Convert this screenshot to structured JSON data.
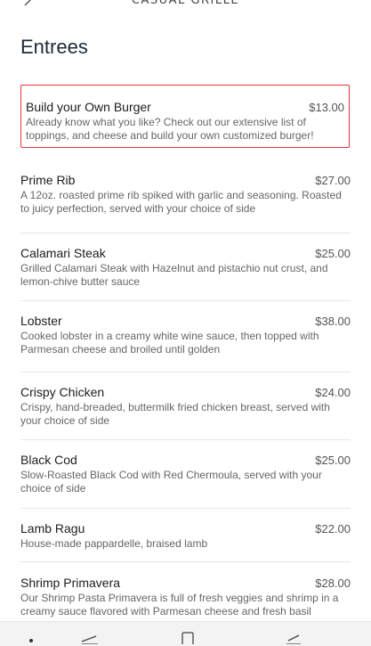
{
  "header": {
    "brand": "CASUAL GRILLE",
    "title": "Entrees"
  },
  "items": [
    {
      "name": "Build your Own Burger",
      "price": "$13.00",
      "description": "Already know what you like? Check out our extensive list of toppings, and cheese and build your own customized burger!",
      "selected": true
    },
    {
      "name": "Prime Rib",
      "price": "$27.00",
      "description": "A 12oz. roasted prime rib spiked with garlic and seasoning. Roasted to juicy perfection, served with your choice of side"
    },
    {
      "name": "Calamari Steak",
      "price": "$25.00",
      "description": "Grilled Calamari Steak with Hazelnut and pistachio nut crust, and lemon-chive butter sauce"
    },
    {
      "name": "Lobster",
      "price": "$38.00",
      "description": "Cooked lobster in a creamy white wine sauce, then topped with Parmesan cheese and broiled until golden"
    },
    {
      "name": "Crispy Chicken",
      "price": "$24.00",
      "description": "Crispy, hand-breaded, buttermilk fried chicken breast, served with your choice of side"
    },
    {
      "name": "Black Cod",
      "price": "$25.00",
      "description": "Slow-Roasted Black Cod with Red Chermoula, served with your choice of side"
    },
    {
      "name": "Lamb Ragu",
      "price": "$22.00",
      "description": "House-made pappardelle, braised lamb"
    },
    {
      "name": "Shrimp Primavera",
      "price": "$28.00",
      "description": "Our Shrimp Pasta Primavera is full of fresh veggies and shrimp in a creamy sauce flavored with Parmesan cheese and fresh basil"
    }
  ],
  "colors": {
    "selected_border": "#e3343a",
    "divider": "#e6e6e6"
  }
}
